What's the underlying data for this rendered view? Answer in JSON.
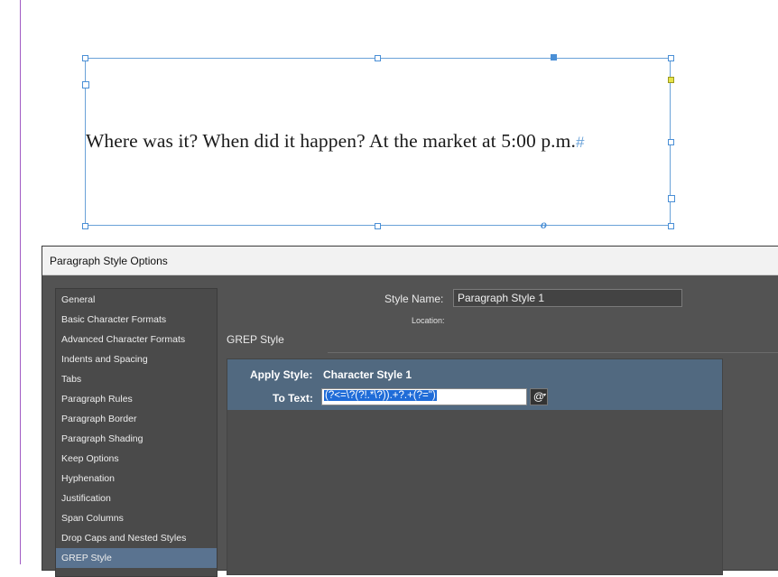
{
  "document": {
    "frame_text": "Where was it? When did it happen? At the market at 5:00 p.m.",
    "pilcrow": "#",
    "overset_marker": "o"
  },
  "dialog": {
    "title": "Paragraph Style Options",
    "style_name_label": "Style Name:",
    "style_name_value": "Paragraph Style 1",
    "location_label": "Location:",
    "section_title": "GREP Style",
    "sidebar_items": [
      {
        "label": "General"
      },
      {
        "label": "Basic Character Formats"
      },
      {
        "label": "Advanced Character Formats"
      },
      {
        "label": "Indents and Spacing"
      },
      {
        "label": "Tabs"
      },
      {
        "label": "Paragraph Rules"
      },
      {
        "label": "Paragraph Border"
      },
      {
        "label": "Paragraph Shading"
      },
      {
        "label": "Keep Options"
      },
      {
        "label": "Hyphenation"
      },
      {
        "label": "Justification"
      },
      {
        "label": "Span Columns"
      },
      {
        "label": "Drop Caps and Nested Styles"
      },
      {
        "label": "GREP Style"
      }
    ],
    "selected_item": "GREP Style",
    "grep": {
      "apply_style_label": "Apply Style:",
      "apply_style_value": "Character Style 1",
      "to_text_label": "To Text:",
      "to_text_value": "(?<=\\?(?!.*\\?)).+?.+(?=\")",
      "special_chars_button": "@"
    }
  },
  "colors": {
    "dialog_bg": "#535353",
    "selection_blue": "#5a7390",
    "grep_row_blue": "#516980",
    "frame_blue": "#6aa2d8",
    "margin_purple": "#a15bc4"
  }
}
